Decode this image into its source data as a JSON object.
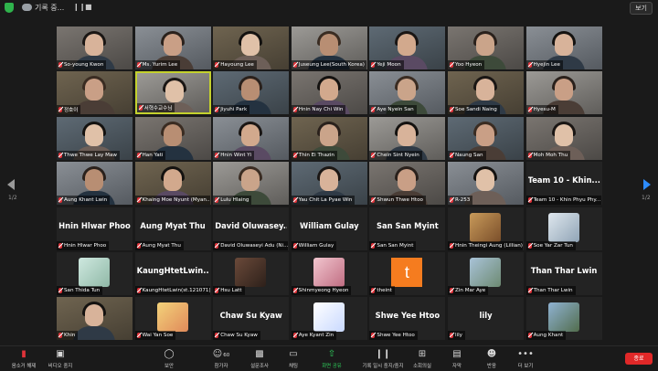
{
  "window": {
    "title": "기록 중...",
    "view_label": "보기",
    "page_left": "1/2",
    "page_right": "1/2"
  },
  "tiles": [
    {
      "name": "So-young Kwon",
      "video": true
    },
    {
      "name": "Ms. Yurim Lee",
      "video": true
    },
    {
      "name": "Hayoung Lee",
      "video": true
    },
    {
      "name": "Juseung Lee(South Korea)",
      "video": true
    },
    {
      "name": "Yeji Moon",
      "video": true
    },
    {
      "name": "Yoo Hyeon",
      "video": true
    },
    {
      "name": "Hyejin Lee",
      "video": true
    },
    {
      "name": "정호이",
      "video": true
    },
    {
      "name": "서혁수교수님",
      "video": true,
      "active": true
    },
    {
      "name": "Jiyuhi Park",
      "video": true
    },
    {
      "name": "Hnin Nay Chi Win",
      "video": true
    },
    {
      "name": "Aye Nyein San",
      "video": true
    },
    {
      "name": "Soe Sandi Naing",
      "video": true
    },
    {
      "name": "Hyesu-M",
      "video": true
    },
    {
      "name": "Thwe Thwe Lay Maw",
      "video": true
    },
    {
      "name": "Han Yati",
      "video": true
    },
    {
      "name": "Hnin Wint Yi",
      "video": true
    },
    {
      "name": "Thin Ei Thazin",
      "video": true
    },
    {
      "name": "Chein Sint Nyein",
      "video": true
    },
    {
      "name": "Naung San",
      "video": true
    },
    {
      "name": "Moh Moh Thu",
      "video": true
    },
    {
      "name": "Aung Khant Lwin",
      "video": true
    },
    {
      "name": "Khaing Moe Nyunt (Myan...",
      "video": true
    },
    {
      "name": "Lulu Hlaing",
      "video": true
    },
    {
      "name": "Yau Chit La Pyae Win",
      "video": true
    },
    {
      "name": "Shwun Thwe Htoo",
      "video": true
    },
    {
      "name": "R-253",
      "video": true
    },
    {
      "name": "Team 10 - Khin Phyu Phy...",
      "big": "Team 10 - Khin..."
    },
    {
      "name": "Hnin Hlwar Phoo",
      "big": "Hnin Hlwar Phoo"
    },
    {
      "name": "Aung Myat Thu",
      "big": "Aung Myat Thu"
    },
    {
      "name": "David Oluwaseyi Adu (Ni...",
      "big": "David Oluwasey..."
    },
    {
      "name": "William Gulay",
      "big": "William Gulay"
    },
    {
      "name": "San San Myint",
      "big": "San San Myint"
    },
    {
      "name": "Hnin Theingi Aung (Lillian)",
      "avatar": "art"
    },
    {
      "name": "Soe Yar Zar Tun",
      "avatar": "person"
    },
    {
      "name": "San Thida Tun",
      "avatar": "sky"
    },
    {
      "name": "KaungHtetLwin(st.121071)",
      "big": "KaungHtetLwin..."
    },
    {
      "name": "Hsu Latt",
      "avatar": "portrait"
    },
    {
      "name": "Shinmyeong Hyeon",
      "avatar": "pink"
    },
    {
      "name": "theint",
      "avatar": "t"
    },
    {
      "name": "Zin Mar Aye",
      "avatar": "outdoor"
    },
    {
      "name": "Than Thar Lwin",
      "big": "Than Thar Lwin"
    },
    {
      "name": "Khin",
      "video": true
    },
    {
      "name": "Wai Yan Soe",
      "avatar": "cartoon"
    },
    {
      "name": "Chaw Su Kyaw",
      "big": "Chaw Su Kyaw"
    },
    {
      "name": "Aye Kyant Zin",
      "avatar": "anime"
    },
    {
      "name": "Shwe Yee Htoo",
      "big": "Shwe Yee Htoo"
    },
    {
      "name": "lily",
      "big": "lily"
    },
    {
      "name": "Aung Khant",
      "avatar": "outdoor2"
    }
  ],
  "toolbar": {
    "mute": "음소거 해제",
    "video": "비디오 중지",
    "security": "보안",
    "participants": "참가자",
    "participant_count": "60",
    "polls": "설문조사",
    "chat": "채팅",
    "share": "화면 공유",
    "record": "기록 일시 중지/중지",
    "breakout": "소회의실",
    "captions": "자막",
    "reactions": "반응",
    "more": "더 보기",
    "leave": "종료"
  },
  "colors": {
    "active_border": "#c4d12d",
    "share_green": "#2fcf5b",
    "leave_red": "#e02828",
    "next_arrow": "#2d8cff",
    "muted_red": "#e0333a"
  }
}
